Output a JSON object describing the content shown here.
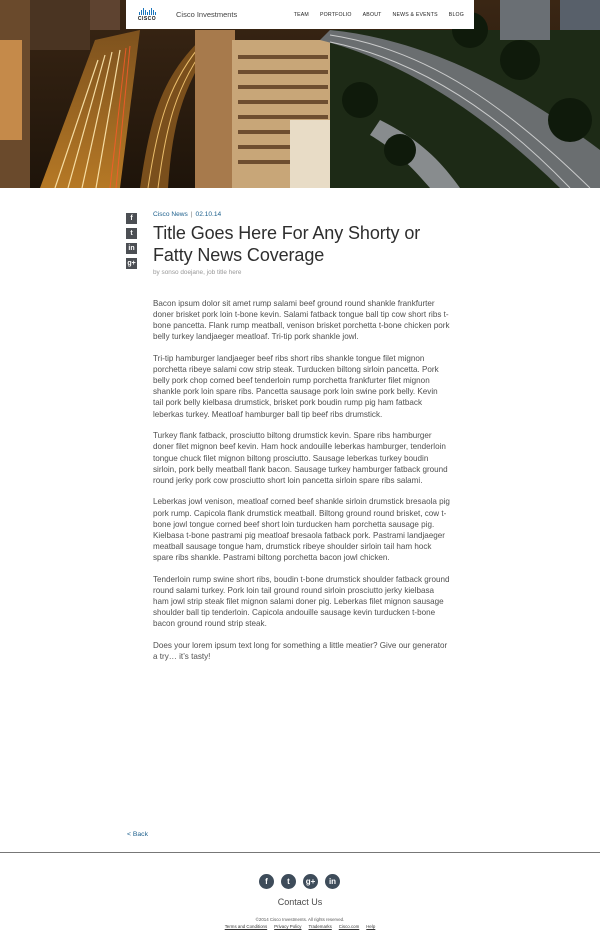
{
  "header": {
    "logo_text": "CISCO",
    "brand": "Cisco Investments",
    "nav": [
      "TEAM",
      "PORTFOLIO",
      "ABOUT",
      "NEWS & EVENTS",
      "BLOG"
    ]
  },
  "share": {
    "facebook": "f",
    "twitter": "t",
    "linkedin": "in",
    "googleplus": "g+"
  },
  "article": {
    "category": "Cisco News",
    "separator": "|",
    "date": "02.10.14",
    "title": "Title Goes Here For Any Shorty or Fatty News Coverage",
    "byline": "by sonso doejane, job title here",
    "paragraphs": [
      "Bacon ipsum dolor sit amet rump salami beef ground round shankle frankfurter doner brisket pork loin t-bone kevin. Salami fatback tongue ball tip cow short ribs t-bone pancetta. Flank rump meatball, venison brisket porchetta t-bone chicken pork belly turkey landjaeger meatloaf. Tri-tip pork shankle jowl.",
      "Tri-tip hamburger landjaeger beef ribs short ribs shankle tongue filet mignon porchetta ribeye salami cow strip steak. Turducken biltong sirloin pancetta. Pork belly pork chop corned beef tenderloin rump porchetta frankfurter filet mignon shankle pork loin spare ribs. Pancetta sausage pork loin swine pork belly. Kevin tail pork belly kielbasa drumstick, brisket pork boudin rump pig ham fatback leberkas turkey. Meatloaf hamburger ball tip beef ribs drumstick.",
      "Turkey flank fatback, prosciutto biltong drumstick kevin. Spare ribs hamburger doner filet mignon beef kevin. Ham hock andouille leberkas hamburger, tenderloin tongue chuck filet mignon biltong prosciutto. Sausage leberkas turkey boudin sirloin, pork belly meatball flank bacon. Sausage turkey hamburger fatback ground round jerky pork cow prosciutto short loin pancetta sirloin spare ribs salami.",
      "Leberkas jowl venison, meatloaf corned beef shankle sirloin drumstick bresaola pig pork rump. Capicola flank drumstick meatball. Biltong ground round brisket, cow t-bone jowl tongue corned beef short loin turducken ham porchetta sausage pig. Kielbasa t-bone pastrami pig meatloaf bresaola fatback pork. Pastrami landjaeger meatball sausage tongue ham, drumstick ribeye shoulder sirloin tail ham hock spare ribs shankle. Pastrami biltong porchetta bacon jowl chicken.",
      "Tenderloin rump swine short ribs, boudin t-bone drumstick shoulder fatback ground round salami turkey. Pork loin tail ground round sirloin prosciutto jerky kielbasa ham jowl strip steak filet mignon salami doner pig. Leberkas filet mignon sausage shoulder ball tip tenderloin. Capicola andouille sausage kevin turducken t-bone bacon ground round strip steak.",
      "Does your lorem ipsum text long for something a little meatier? Give our generator a try… it’s tasty!"
    ]
  },
  "back_link": "< Back",
  "footer": {
    "social": [
      "f",
      "t",
      "g+",
      "in"
    ],
    "contact": "Contact Us",
    "copyright": "©2014 Cisco Investments. All rights reserved.",
    "links": [
      "Terms and Conditions",
      "Privacy Policy",
      "Trademarks",
      "Cisco.com",
      "Help"
    ]
  },
  "colors": {
    "accent": "#1c5f8c",
    "logo_blue": "#1b75bb",
    "share_bg": "#4c4f54",
    "footer_icon_bg": "#3e4c5a"
  }
}
